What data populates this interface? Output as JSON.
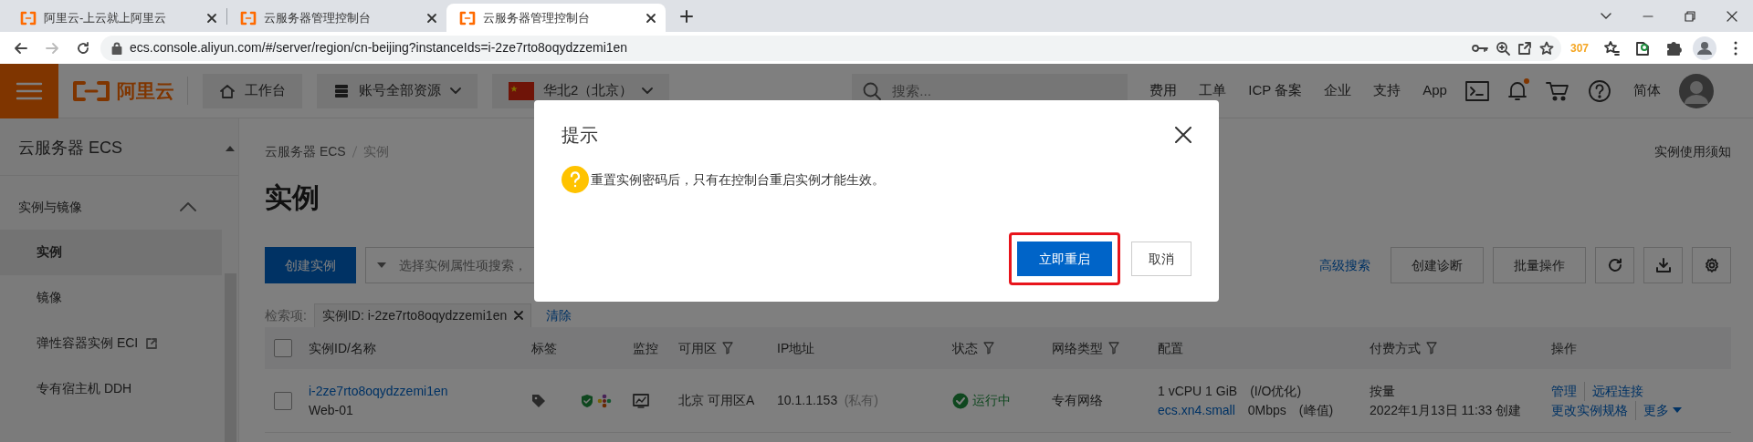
{
  "browser": {
    "tabs": [
      {
        "title": "阿里云-上云就上阿里云",
        "selected": false
      },
      {
        "title": "云服务器管理控制台",
        "selected": false
      },
      {
        "title": "云服务器管理控制台",
        "selected": true
      }
    ],
    "url": "ecs.console.aliyun.com/#/server/region/cn-beijing?instanceIds=i-2ze7rto8oqydzzemi1en",
    "extension_badge": "307"
  },
  "console_nav": {
    "logo_text": "阿里云",
    "workbench": "工作台",
    "resources": "账号全部资源",
    "region": "华北2（北京）",
    "search_placeholder": "搜索...",
    "links": [
      "费用",
      "工单",
      "ICP 备案",
      "企业",
      "支持",
      "App"
    ],
    "notification_dot": true,
    "language": "简体"
  },
  "sidebar": {
    "title": "云服务器 ECS",
    "group": {
      "label": "实例与镜像",
      "expanded": true,
      "items": [
        {
          "label": "实例",
          "selected": true,
          "external": false
        },
        {
          "label": "镜像",
          "selected": false,
          "external": false
        },
        {
          "label": "弹性容器实例 ECI",
          "selected": false,
          "external": true
        },
        {
          "label": "专有宿主机 DDH",
          "selected": false,
          "external": false
        }
      ]
    }
  },
  "breadcrumb": [
    "云服务器 ECS",
    "实例"
  ],
  "notice_link": "实例使用须知",
  "page_title": "实例",
  "toolbar": {
    "create_button": "创建实例",
    "search_placeholder": "选择实例属性项搜索，",
    "advanced_search": "高级搜索",
    "buttons": [
      "创建诊断",
      "批量操作"
    ]
  },
  "filter": {
    "label": "检索项:",
    "tags": [
      "实例ID: i-2ze7rto8oqydzzemi1en"
    ],
    "clear": "清除"
  },
  "table": {
    "all_checked": false,
    "columns": [
      {
        "label": "实例ID/名称",
        "filter": false
      },
      {
        "label": "标签",
        "filter": false
      },
      {
        "label": "监控",
        "filter": false
      },
      {
        "label": "可用区",
        "filter": true
      },
      {
        "label": "IP地址",
        "filter": false
      },
      {
        "label": "状态",
        "filter": true
      },
      {
        "label": "网络类型",
        "filter": true
      },
      {
        "label": "配置",
        "filter": false
      },
      {
        "label": "付费方式",
        "filter": true
      },
      {
        "label": "操作",
        "filter": false
      }
    ],
    "rows": [
      {
        "checked": false,
        "instance_id": "i-2ze7rto8oqydzzemi1en",
        "name": "Web-01",
        "zone": "北京 可用区A",
        "ip": "10.1.1.153",
        "ip_type": "(私有)",
        "status": {
          "label": "运行中",
          "running": true
        },
        "network": "专有网络",
        "config": {
          "spec": "1 vCPU 1 GiB",
          "spec_note": "(I/O优化)",
          "instance_type": "ecs.xn4.small",
          "bandwidth": "0Mbps",
          "bandwidth_note": "(峰值)"
        },
        "billing": "按量",
        "created": "2022年1月13日 11:33 创建",
        "actions": [
          [
            {
              "label": "管理",
              "dropdown": false
            },
            {
              "label": "远程连接",
              "dropdown": false
            }
          ],
          [
            {
              "label": "更改实例规格",
              "dropdown": false
            },
            {
              "label": "更多",
              "dropdown": true
            }
          ]
        ]
      }
    ]
  },
  "dialog": {
    "title": "提示",
    "message": "重置实例密码后，只有在控制台重启实例才能生效。",
    "buttons": [
      {
        "label": "立即重启",
        "kind": "primary",
        "highlighted": true
      },
      {
        "label": "取消",
        "kind": "default",
        "highlighted": false
      }
    ]
  }
}
